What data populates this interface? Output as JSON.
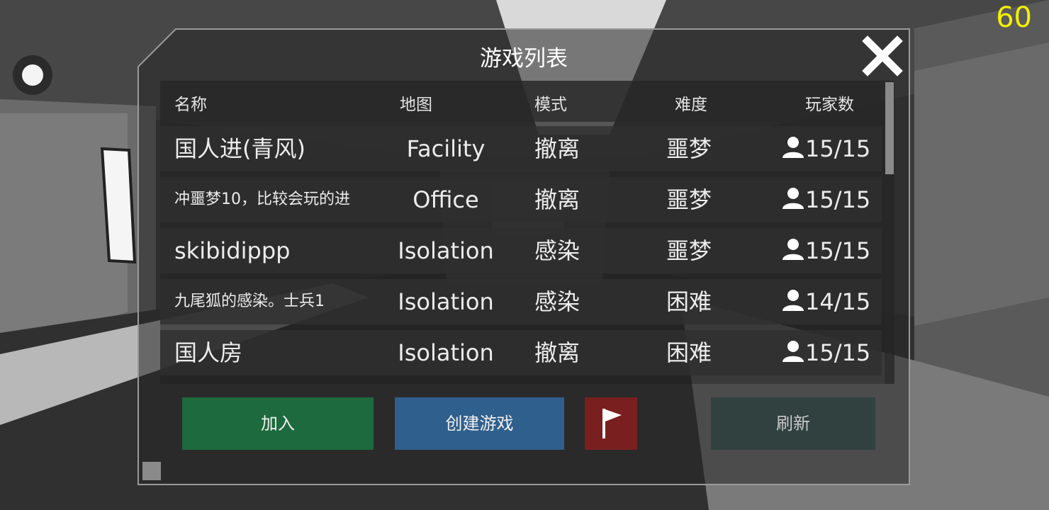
{
  "hud": {
    "fps": "60"
  },
  "panel": {
    "title": "游戏列表",
    "columns": {
      "name": "名称",
      "map": "地图",
      "mode": "模式",
      "difficulty": "难度",
      "players": "玩家数"
    },
    "rows": [
      {
        "name": "国人进(青风)",
        "map": "Facility",
        "mode": "撤离",
        "difficulty": "噩梦",
        "players": "15/15"
      },
      {
        "name": "冲噩梦10，比较会玩的进",
        "map": "Office",
        "mode": "撤离",
        "difficulty": "噩梦",
        "players": "15/15"
      },
      {
        "name": "skibidippp",
        "map": "Isolation",
        "mode": "感染",
        "difficulty": "噩梦",
        "players": "15/15"
      },
      {
        "name": "九尾狐的感染。士兵1",
        "map": "Isolation",
        "mode": "感染",
        "difficulty": "困难",
        "players": "14/15"
      },
      {
        "name": "国人房",
        "map": "Isolation",
        "mode": "撤离",
        "difficulty": "困难",
        "players": "15/15"
      }
    ],
    "scroll_position": 0.0
  },
  "buttons": {
    "join": "加入",
    "create": "创建游戏",
    "report_icon": "flag-icon",
    "refresh": "刷新"
  },
  "colors": {
    "join": "#1c6a3d",
    "create": "#2f5f8c",
    "flag": "#7a1f1f",
    "refresh": "#31413f",
    "fps": "#f2f000"
  }
}
